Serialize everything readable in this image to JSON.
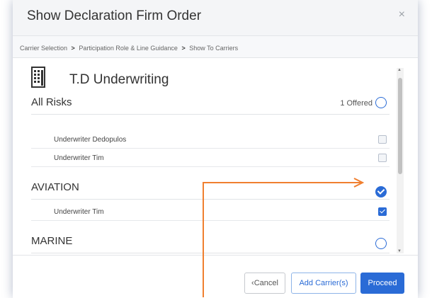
{
  "modal": {
    "title": "Show Declaration Firm Order",
    "close_label": "×"
  },
  "breadcrumb": {
    "steps": [
      "Carrier Selection",
      "Participation Role & Line Guidance",
      "Show To Carriers"
    ],
    "separator": ">"
  },
  "company": {
    "name": "T.D Underwriting",
    "icon": "building-icon"
  },
  "categories": [
    {
      "name": "All Risks",
      "offered": "1 Offered",
      "selected": false,
      "underwriters": [
        {
          "name": "Underwriter Dedopulos",
          "checked": false
        },
        {
          "name": "Underwriter Tim",
          "checked": false
        }
      ]
    },
    {
      "name": "AVIATION",
      "offered": "",
      "selected": true,
      "underwriters": [
        {
          "name": "Underwriter Tim",
          "checked": true
        }
      ]
    },
    {
      "name": "MARINE",
      "offered": "",
      "selected": false,
      "underwriters": []
    }
  ],
  "footer": {
    "cancel_label": "‹Cancel",
    "add_carriers_label": "Add Carrier(s)",
    "proceed_label": "Proceed"
  },
  "colors": {
    "accent": "#2a6bd6",
    "annotation_arrow": "#f07f2f"
  }
}
